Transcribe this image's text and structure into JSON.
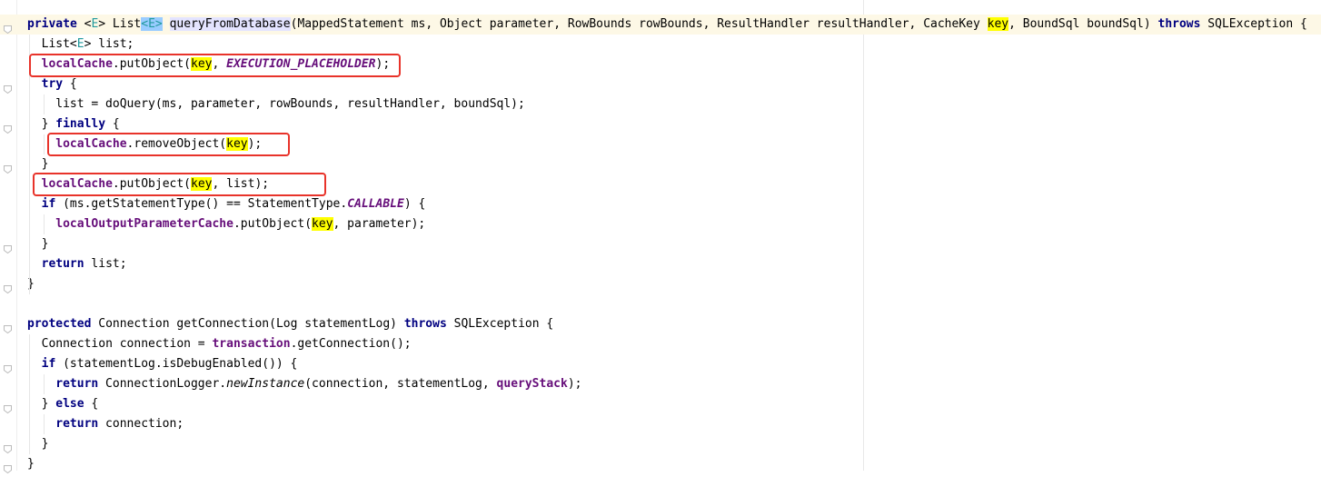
{
  "colors": {
    "keyword": "#000080",
    "field": "#660e7a",
    "highlight": "#ffff00",
    "annotation_box": "#e8332a"
  },
  "lines": [
    {
      "indent": 0,
      "current": true,
      "tokens": [
        [
          "private",
          "kw"
        ],
        [
          " <",
          ""
        ],
        [
          "E",
          "tp"
        ],
        [
          "> List",
          ""
        ],
        [
          "<",
          "tpsel"
        ],
        [
          "E",
          "tpsel"
        ],
        [
          ">",
          "tpsel"
        ],
        [
          " ",
          ""
        ],
        [
          "queryFromDatabase",
          "mth"
        ],
        [
          "(MappedStatement ms, Object parameter, RowBounds rowBounds, ResultHandler resultHandler, CacheKey ",
          ""
        ],
        [
          "key",
          "hl"
        ],
        [
          ", BoundSql boundSql) ",
          ""
        ],
        [
          "throws",
          "kw"
        ],
        [
          " SQLException {",
          ""
        ]
      ]
    },
    {
      "indent": 1,
      "tokens": [
        [
          "List<",
          ""
        ],
        [
          "E",
          "tp"
        ],
        [
          "> list;",
          ""
        ]
      ]
    },
    {
      "indent": 1,
      "tokens": [
        [
          "localCache",
          "fld"
        ],
        [
          ".putObject(",
          ""
        ],
        [
          "key",
          "hl"
        ],
        [
          ", ",
          ""
        ],
        [
          "EXECUTION_PLACEHOLDER",
          "cst"
        ],
        [
          ");",
          ""
        ]
      ]
    },
    {
      "indent": 1,
      "tokens": [
        [
          "try",
          "kw"
        ],
        [
          " {",
          ""
        ]
      ]
    },
    {
      "indent": 2,
      "tokens": [
        [
          "list = doQuery(ms, parameter, rowBounds, resultHandler, boundSql);",
          ""
        ]
      ]
    },
    {
      "indent": 1,
      "tokens": [
        [
          "} ",
          ""
        ],
        [
          "finally",
          "kw"
        ],
        [
          " {",
          ""
        ]
      ]
    },
    {
      "indent": 2,
      "tokens": [
        [
          "localCache",
          "fld"
        ],
        [
          ".removeObject(",
          ""
        ],
        [
          "key",
          "hl"
        ],
        [
          ");",
          ""
        ]
      ]
    },
    {
      "indent": 1,
      "tokens": [
        [
          "}",
          ""
        ]
      ]
    },
    {
      "indent": 1,
      "tokens": [
        [
          "localCache",
          "fld"
        ],
        [
          ".putObject(",
          ""
        ],
        [
          "key",
          "hl"
        ],
        [
          ", list);",
          ""
        ]
      ]
    },
    {
      "indent": 1,
      "tokens": [
        [
          "if",
          "kw"
        ],
        [
          " (ms.getStatementType() == StatementType.",
          ""
        ],
        [
          "CALLABLE",
          "cst"
        ],
        [
          ") {",
          ""
        ]
      ]
    },
    {
      "indent": 2,
      "tokens": [
        [
          "localOutputParameterCache",
          "fld"
        ],
        [
          ".putObject(",
          ""
        ],
        [
          "key",
          "hl"
        ],
        [
          ", parameter);",
          ""
        ]
      ]
    },
    {
      "indent": 1,
      "tokens": [
        [
          "}",
          ""
        ]
      ]
    },
    {
      "indent": 1,
      "tokens": [
        [
          "return",
          "kw"
        ],
        [
          " list;",
          ""
        ]
      ]
    },
    {
      "indent": 0,
      "tokens": [
        [
          "}",
          ""
        ]
      ]
    },
    {
      "indent": 0,
      "tokens": []
    },
    {
      "indent": 0,
      "tokens": [
        [
          "protected",
          "kw"
        ],
        [
          " Connection getConnection(Log statementLog) ",
          ""
        ],
        [
          "throws",
          "kw"
        ],
        [
          " SQLException {",
          ""
        ]
      ]
    },
    {
      "indent": 1,
      "tokens": [
        [
          "Connection connection = ",
          ""
        ],
        [
          "transaction",
          "fld"
        ],
        [
          ".getConnection();",
          ""
        ]
      ]
    },
    {
      "indent": 1,
      "tokens": [
        [
          "if",
          "kw"
        ],
        [
          " (statementLog.isDebugEnabled()) {",
          ""
        ]
      ]
    },
    {
      "indent": 2,
      "tokens": [
        [
          "return",
          "kw"
        ],
        [
          " ConnectionLogger.",
          ""
        ],
        [
          "newInstance",
          "st"
        ],
        [
          "(connection, statementLog, ",
          ""
        ],
        [
          "queryStack",
          "fld"
        ],
        [
          ");",
          ""
        ]
      ]
    },
    {
      "indent": 1,
      "tokens": [
        [
          "} ",
          ""
        ],
        [
          "else",
          "kw"
        ],
        [
          " {",
          ""
        ]
      ]
    },
    {
      "indent": 2,
      "tokens": [
        [
          "return",
          "kw"
        ],
        [
          " connection;",
          ""
        ]
      ]
    },
    {
      "indent": 1,
      "tokens": [
        [
          "}",
          ""
        ]
      ]
    },
    {
      "indent": 0,
      "tokens": [
        [
          "}",
          ""
        ]
      ]
    }
  ]
}
